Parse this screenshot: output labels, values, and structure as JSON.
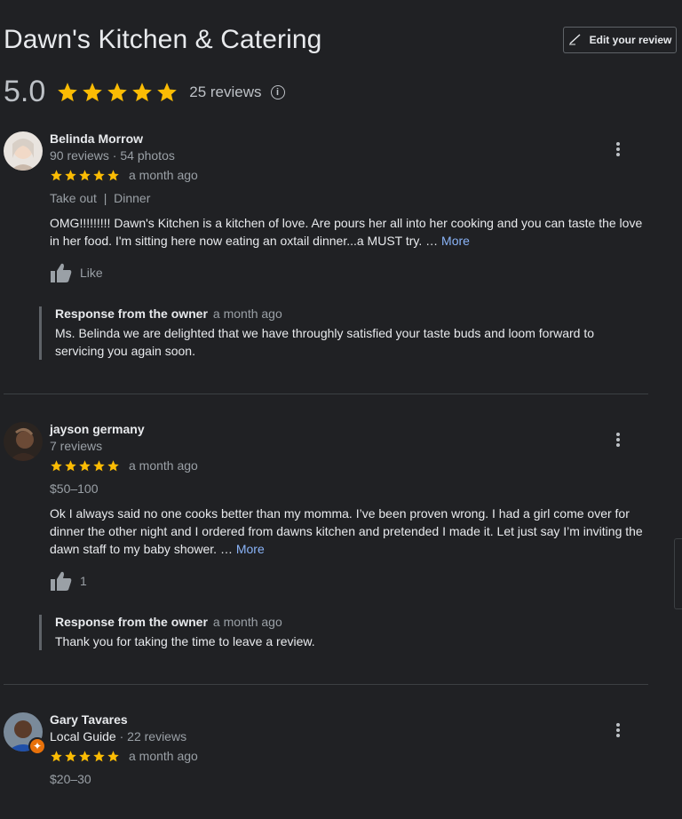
{
  "place": {
    "title": "Dawn's Kitchen & Catering",
    "edit_review_label": "Edit your review",
    "rating": "5.0",
    "review_count": "25 reviews",
    "info_glyph": "i"
  },
  "reviews": [
    {
      "name": "Belinda Morrow",
      "meta": "90 reviews · 54 photos",
      "rating": 5,
      "when": "a month ago",
      "tags": "Take out  |  Dinner",
      "text": "OMG!!!!!!!!! Dawn's Kitchen is a kitchen of love. Are pours her all into her cooking and you can taste the love in her food. I'm sitting here now eating an oxtail dinner...a MUST try. …",
      "more": "More",
      "like_label": "Like",
      "response": {
        "heading": "Response from the owner",
        "when": "a month ago",
        "text": "Ms. Belinda we are delighted that we have throughly satisfied your taste buds and loom forward to servicing you again soon."
      }
    },
    {
      "name": "jayson germany",
      "meta": "7 reviews",
      "rating": 5,
      "when": "a month ago",
      "tags": "$50–100",
      "text": "Ok I always said no one cooks better than my momma. I’ve been proven wrong. I had a girl come over for dinner the other night and I ordered from dawns kitchen and pretended I made it. Let just say I’m inviting the dawn staff to my baby shower. …",
      "more": "More",
      "like_label": "1",
      "response": {
        "heading": "Response from the owner",
        "when": "a month ago",
        "text": "Thank you for taking the time to leave a review."
      }
    },
    {
      "name": "Gary Tavares",
      "meta_strong": "Local Guide",
      "meta": " · 22 reviews",
      "rating": 5,
      "when": "a month ago",
      "tags": "$20–30"
    }
  ],
  "colors": {
    "background": "#202124",
    "star": "#fbbc04",
    "link": "#8ab4f8",
    "muted": "#9aa0a6"
  },
  "icons": [
    "pencil-icon",
    "star-icon",
    "info-icon",
    "thumbs-up-icon",
    "more-vert-icon",
    "local-guide-badge-icon"
  ]
}
